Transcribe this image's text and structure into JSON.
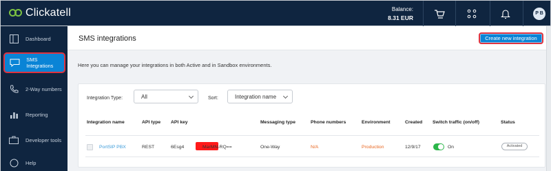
{
  "app": {
    "brand": "Clickatell"
  },
  "topbar": {
    "balance_label": "Balance:",
    "balance_value": "8.31 EUR",
    "icons": [
      "cart-icon",
      "apps-grid-icon",
      "bell-icon"
    ],
    "user_initials": "P B"
  },
  "sidebar": {
    "items": [
      {
        "label": "Dashboard",
        "icon": "dashboard-icon",
        "active": false
      },
      {
        "label": "SMS Integrations",
        "icon": "chat-icon",
        "active": true
      },
      {
        "label": "2-Way numbers",
        "icon": "phone-icon",
        "active": false
      },
      {
        "label": "Reporting",
        "icon": "chart-icon",
        "active": false
      },
      {
        "label": "Developer tools",
        "icon": "briefcase-icon",
        "active": false
      },
      {
        "label": "Help",
        "icon": "help-icon",
        "active": false
      }
    ]
  },
  "header": {
    "title": "SMS integrations",
    "create_button": "Create new integration"
  },
  "intro_text": "Here you can manage your integrations in both Active and in Sandbox environments.",
  "filters": {
    "type_label": "Integration Type:",
    "type_value": "All",
    "sort_label": "Sort:",
    "sort_value": "Integration name"
  },
  "table": {
    "columns": [
      "Integration name",
      "API type",
      "API key",
      "Messaging type",
      "Phone numbers",
      "Environment",
      "Created",
      "Switch traffic (on/off)",
      "Status"
    ],
    "rows": [
      {
        "name": "PortSIP PBX",
        "api_type": "REST",
        "api_key_start": "6Esg4",
        "api_key_end": "MarMN-RQ==",
        "messaging_type": "One-Way",
        "phone_numbers": "N/A",
        "environment": "Production",
        "created": "12/9/17",
        "switch_state": "On",
        "status": "Activated"
      }
    ]
  },
  "colors": {
    "navy": "#0f2540",
    "accent_blue": "#0a84d6",
    "highlight_red": "#e0333f",
    "toggle_green": "#2cb64a",
    "warning_orange": "#e8651f"
  }
}
